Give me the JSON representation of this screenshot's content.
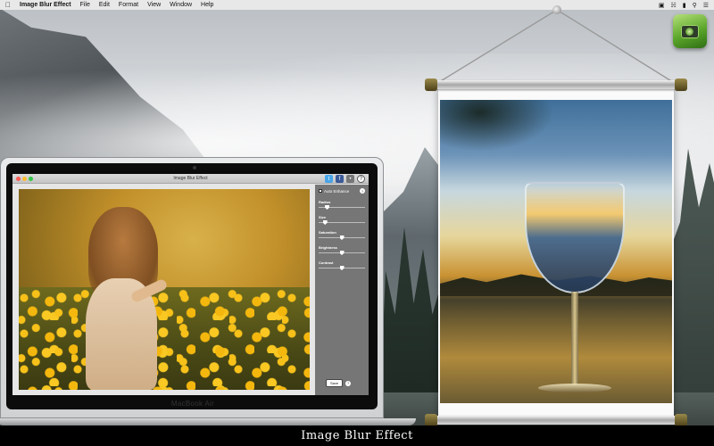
{
  "menubar": {
    "apple": "",
    "app_name": "Image Blur Effect",
    "items": [
      "File",
      "Edit",
      "Format",
      "View",
      "Window",
      "Help"
    ],
    "status_icons": [
      "wifi-icon",
      "battery-icon",
      "search-icon",
      "list-icon"
    ]
  },
  "app_window": {
    "title": "Image Blur Effect",
    "share_icons": [
      "twitter-icon",
      "facebook-icon",
      "flickr-icon",
      "help-icon"
    ],
    "auto_enhance_label": "Auto Enhance",
    "auto_enhance_checked": false,
    "sliders": [
      {
        "label": "Radius",
        "value": 0.15
      },
      {
        "label": "Size",
        "value": 0.1
      },
      {
        "label": "Saturation",
        "value": 0.5
      },
      {
        "label": "Brightness",
        "value": 0.5
      },
      {
        "label": "Contrast",
        "value": 0.5
      }
    ],
    "save_label": "Save"
  },
  "laptop_label": "MacBook Air",
  "caption": "Image Blur Effect",
  "colors": {
    "menubar_bg": "#ebebeb",
    "panel_bg": "#767676",
    "caption_bg": "#000000",
    "dock_icon_green": "#5aa62a"
  }
}
